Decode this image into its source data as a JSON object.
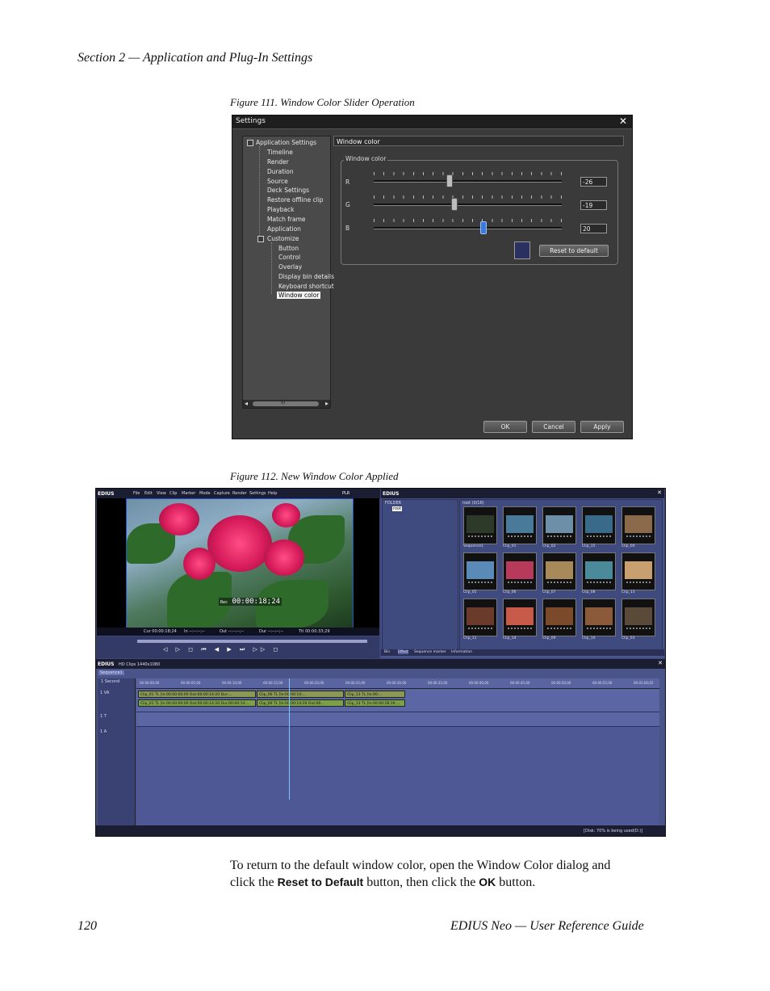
{
  "header": {
    "section": "Section 2 — Application and Plug-In Settings"
  },
  "figure111": {
    "caption": "Figure 111.  Window Color Slider Operation",
    "dialog_title": "Settings",
    "close_glyph": "✕",
    "tree": {
      "root": "Application Settings",
      "items": [
        "Timeline",
        "Render",
        "Duration",
        "Source",
        "Deck Settings",
        "Restore offline clip",
        "Playback",
        "Match frame",
        "Application"
      ],
      "customize": "Customize",
      "customize_items": [
        "Button",
        "Control",
        "Overlay",
        "Display bin details",
        "Keyboard shortcut"
      ],
      "selected": "Window color",
      "scroll_thumb": "III"
    },
    "panel_title": "Window color",
    "group_label": "Window color",
    "sliders": [
      {
        "label": "R",
        "value": "-26",
        "level": -26
      },
      {
        "label": "G",
        "value": "-19",
        "level": -19
      },
      {
        "label": "B",
        "value": "20",
        "level": 20
      }
    ],
    "swatch_color": "#2a3060",
    "reset_button": "Reset to default",
    "ok_button": "OK",
    "cancel_button": "Cancel",
    "apply_button": "Apply"
  },
  "figure112": {
    "caption": "Figure 112.  New Window Color Applied",
    "menu": [
      "EDIUS",
      "File",
      "Edit",
      "View",
      "Clip",
      "Marker",
      "Mode",
      "Capture",
      "Render",
      "Settings",
      "Help"
    ],
    "plr": "PLR",
    "timecode": "00:00:18;24",
    "rec_label": "Rec",
    "status": {
      "cur": "Cur 00:00:18;24",
      "in": "In --:--:--;--",
      "out": "Out --:--:--;--",
      "dur": "Dur --:--:--;--",
      "ttl": "Ttl 00:00:33;29"
    },
    "bin_title": "EDIUS",
    "folder_label": "FOLDER",
    "root_label": "root",
    "bin_path": "root (0/16)",
    "clips": [
      "Sequence1",
      "Clip_01",
      "Clip_02",
      "Clip_15",
      "Clip_04",
      "Clip_05",
      "Clip_06",
      "Clip_07",
      "Clip_08",
      "Clip_13",
      "Clip_11",
      "Clip_14",
      "Clip_09",
      "Clip_10",
      "Clip_03"
    ],
    "tabs": [
      "Bin",
      "Effect",
      "Sequence marker",
      "Information"
    ],
    "project_label": "EDIUS",
    "project_format": "HD Clips 1440x1080",
    "sequence_tab": "Sequence1",
    "scale": "1 Second",
    "ruler": [
      "00:00:00;00",
      "00:00:05;00",
      "00:00:10;00",
      "00:00:15;00",
      "00:00:20;00",
      "00:00:25;00",
      "00:00:30;00",
      "00:00:35;00",
      "00:00:40;00",
      "00:00:45;00",
      "00:00:50;00",
      "00:00:55;00",
      "00:01:00;02"
    ],
    "track_names": [
      "1 VA",
      "1 T",
      "1 A"
    ],
    "track_clips": [
      "Clip_01  TL [In:00:00:00:00 Out:00:00:14:20 Dur:...",
      "Clip_06  TL [In:00:00:14:...",
      "Clip_13  TL [In:00:...",
      "Clip_01  TL [In:00:00:00:00 Out:00:00:14:20 Dur:00:00:14:...",
      "Clip_06  TL [In:00:00:14:20 Out:00...",
      "Clip_13  TL [In:00:00:28:19 ..."
    ],
    "disk_status": "[Disk: 70% is being used(D:)]"
  },
  "body": {
    "line1": "To return to the default window color, open the Window Color dialog and",
    "line2_prefix": "click the",
    "reset_label": "Reset to Default",
    "line2_mid": "button, then click the",
    "ok_label": "OK",
    "line2_suffix": "button."
  },
  "footer": {
    "page": "120",
    "guide": "EDIUS Neo  —  User Reference Guide"
  }
}
